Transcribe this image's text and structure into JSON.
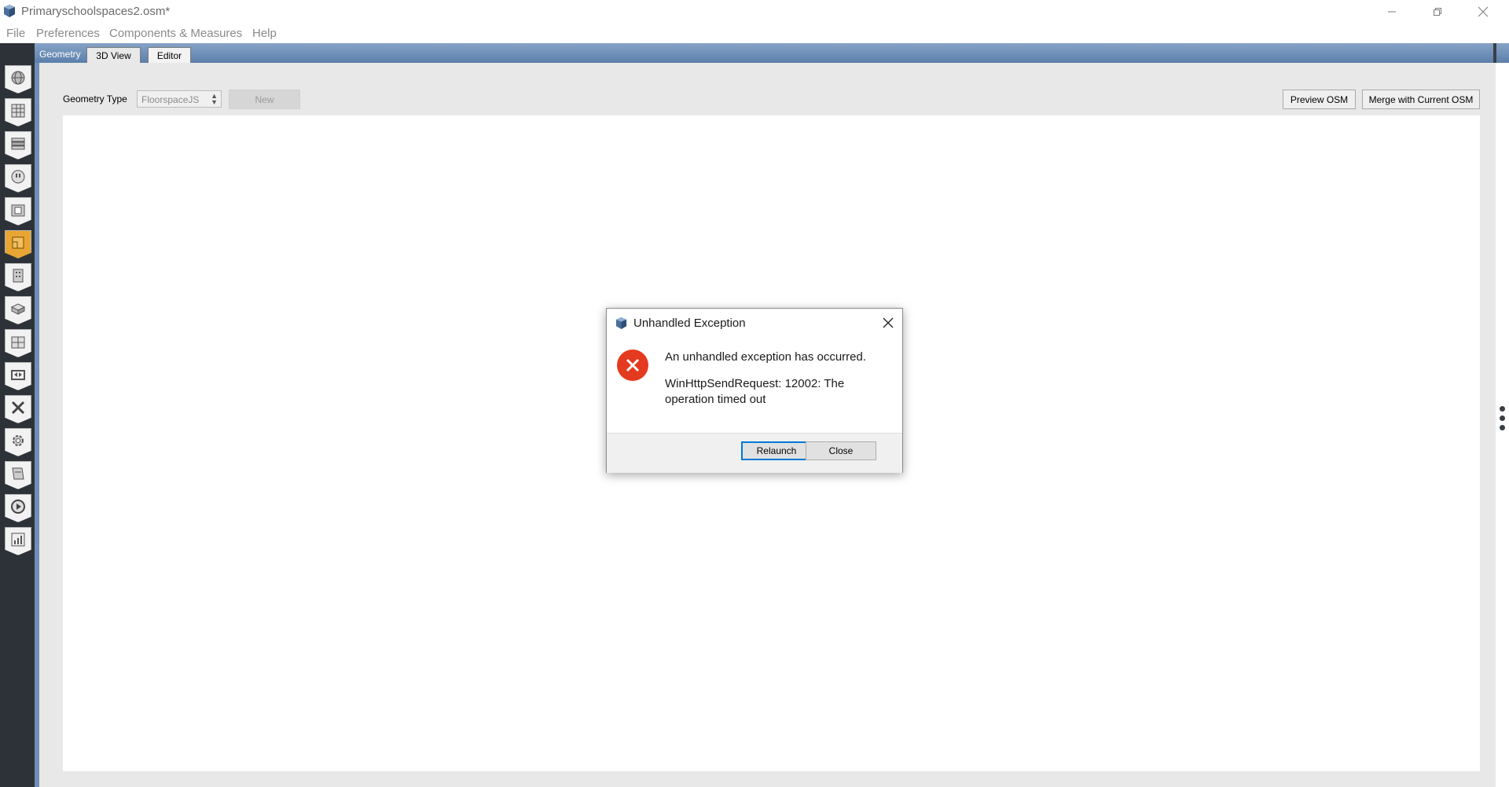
{
  "window": {
    "title": "Primaryschoolspaces2.osm*",
    "icon": "openstudio-cube-icon"
  },
  "menu": [
    "File",
    "Preferences",
    "Components & Measures",
    "Help"
  ],
  "tabs": {
    "section_label": "Geometry",
    "items": [
      "3D View",
      "Editor"
    ],
    "active": "Editor"
  },
  "toolbar": {
    "geometry_type_label": "Geometry Type",
    "geometry_type_value": "FloorspaceJS",
    "new_label": "New",
    "preview_label": "Preview OSM",
    "merge_label": "Merge with Current OSM"
  },
  "left_tools": [
    "site-icon",
    "schedules-icon",
    "constructions-icon",
    "loads-icon",
    "space-types-icon",
    "geometry-icon",
    "facility-icon",
    "spaces-icon",
    "thermal-zones-icon",
    "hvac-systems-icon",
    "building-summary-icon",
    "measures-icon",
    "simulation-settings-icon",
    "run-simulation-icon",
    "results-summary-icon"
  ],
  "dialog": {
    "title": "Unhandled Exception",
    "message": "An unhandled exception has occurred.",
    "detail": "WinHttpSendRequest: 12002: The operation timed out",
    "relaunch_label": "Relaunch",
    "close_label": "Close",
    "icon": "error-icon"
  },
  "colors": {
    "accent_blue": "#5b7fab",
    "active_tool": "#e8a533",
    "error_red": "#e43a1f",
    "primary_button_border": "#0078d7"
  }
}
